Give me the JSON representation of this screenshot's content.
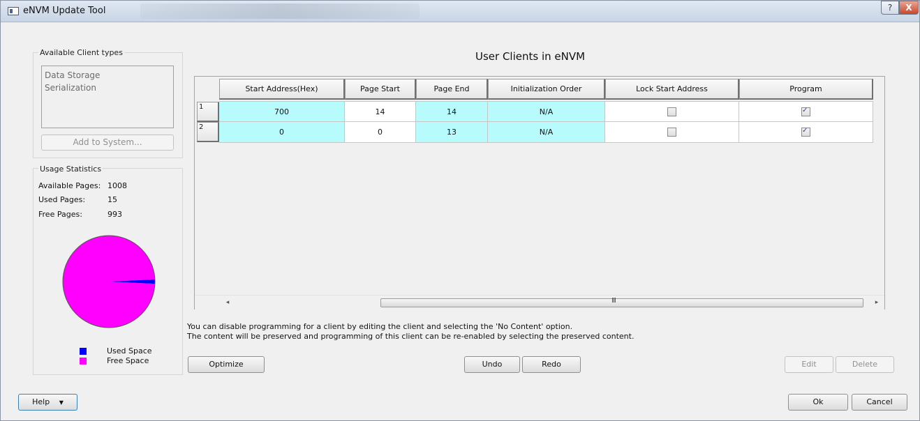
{
  "window": {
    "title": "eNVM Update Tool",
    "help_glyph": "?",
    "close_glyph": "X"
  },
  "client_types": {
    "title": "Available Client types",
    "items": [
      "Data Storage",
      "Serialization"
    ],
    "add_button": "Add to System..."
  },
  "usage": {
    "title": "Usage Statistics",
    "available_label": "Available Pages:",
    "available_value": "1008",
    "used_label": "Used Pages:",
    "used_value": "15",
    "free_label": "Free Pages:",
    "free_value": "993",
    "legend": [
      {
        "label": "Used Space",
        "color": "#0000ff"
      },
      {
        "label": "Free Space",
        "color": "#ff00ff"
      }
    ],
    "chart_data": {
      "type": "pie",
      "labels": [
        "Used Space",
        "Free Space"
      ],
      "values": [
        15,
        993
      ],
      "colors": [
        "#0000ff",
        "#ff00ff"
      ]
    }
  },
  "main": {
    "title": "User Clients in eNVM",
    "columns": [
      "Start Address(Hex)",
      "Page Start",
      "Page End",
      "Initialization Order",
      "Lock Start Address",
      "Program"
    ],
    "rows": [
      {
        "num": "1",
        "start": "700",
        "page_start": "14",
        "page_end": "14",
        "init": "N/A",
        "lock": false,
        "program": true
      },
      {
        "num": "2",
        "start": "0",
        "page_start": "0",
        "page_end": "13",
        "init": "N/A",
        "lock": false,
        "program": true
      }
    ],
    "info_line1": "You can disable programming for a client by editing the client and selecting the 'No Content' option.",
    "info_line2": "The content will be preserved and programming of this client can be re-enabled by selecting the preserved content.",
    "scroll_grip": "III",
    "scroll_left": "◂",
    "scroll_right": "▸"
  },
  "buttons": {
    "optimize": "Optimize",
    "undo": "Undo",
    "redo": "Redo",
    "edit": "Edit",
    "delete": "Delete",
    "help": "Help",
    "help_arrow": "▼",
    "ok": "Ok",
    "cancel": "Cancel"
  }
}
